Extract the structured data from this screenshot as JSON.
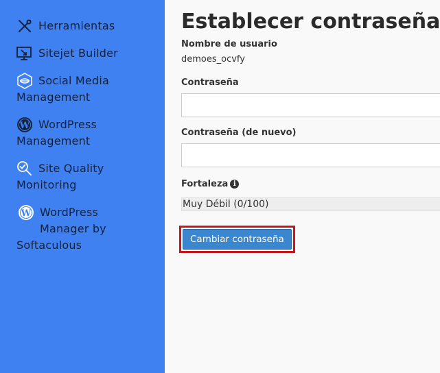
{
  "sidebar": {
    "items": [
      {
        "label": "Herramientas",
        "icon": "tools-icon"
      },
      {
        "label": "Sitejet Builder",
        "icon": "sitejet-icon"
      },
      {
        "label_line1": "Social Media",
        "label_line2": "Management",
        "icon": "social-media-icon"
      },
      {
        "label_line1": "WordPress",
        "label_line2": "Management",
        "icon": "wordpress-icon"
      },
      {
        "label_line1": "Site Quality",
        "label_line2": "Monitoring",
        "icon": "site-quality-icon"
      },
      {
        "label_line1": "WordPress",
        "label_line2": "Manager by",
        "label_line3": "Softaculous",
        "icon": "wordpress-icon"
      }
    ]
  },
  "main": {
    "title": "Establecer contraseña de u",
    "username_label": "Nombre de usuario",
    "username_value": "demoes_ocvfy",
    "password_label": "Contraseña",
    "password_value": "",
    "password_repeat_label": "Contraseña (de nuevo)",
    "password_repeat_value": "",
    "strength_label": "Fortaleza",
    "strength_text": "Muy Débil (0/100)",
    "strength_percent": 0,
    "submit_label": "Cambiar contraseña"
  },
  "colors": {
    "sidebar_bg": "#3f81f0",
    "button_bg": "#3a87cf",
    "highlight_border": "#c4161c"
  }
}
